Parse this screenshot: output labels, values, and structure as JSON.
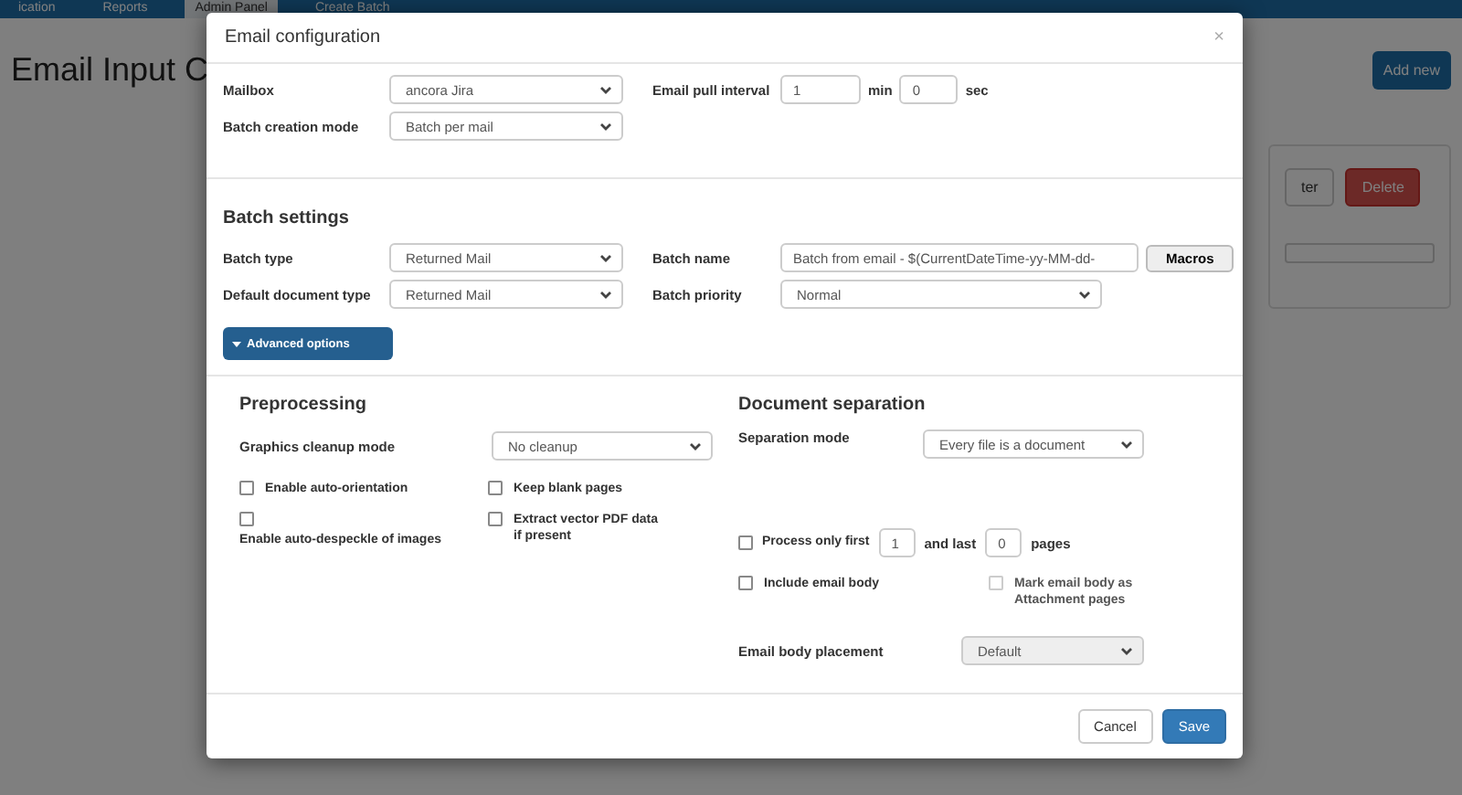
{
  "background": {
    "nav_tabs": [
      {
        "label": "ication",
        "selected": false
      },
      {
        "label": "Reports",
        "selected": false
      },
      {
        "label": "Admin Panel",
        "selected": true
      },
      {
        "label": "Create Batch",
        "selected": false
      }
    ],
    "page_title": "Email Input C",
    "add_button": "Add new",
    "card_buttons": [
      {
        "label": "ter",
        "kind": "default"
      },
      {
        "label": "Delete",
        "kind": "danger"
      }
    ]
  },
  "dialog": {
    "title": "Email configuration",
    "close": "×",
    "general": {
      "mailbox": {
        "label": "Mailbox",
        "value": "ancora Jira"
      },
      "creation_mode": {
        "label": "Batch creation mode",
        "value": "Batch per mail"
      },
      "pull_interval": {
        "label": "Email pull interval",
        "minutes": "1",
        "min_unit": "min",
        "seconds": "0",
        "sec_unit": "sec"
      }
    },
    "batch_settings": {
      "heading": "Batch settings",
      "batch_type": {
        "label": "Batch type",
        "value": "Returned Mail"
      },
      "batch_name": {
        "label": "Batch name",
        "value": "Batch from email - $(CurrentDateTime-yy-MM-dd-",
        "button": "Macros"
      },
      "document_type": {
        "label": "Default document type",
        "value": "Returned Mail"
      },
      "priority": {
        "label": "Batch priority",
        "value": "Normal"
      },
      "advanced": {
        "label": "Advanced options",
        "expanded": true
      }
    },
    "preprocessing": {
      "heading": "Preprocessing",
      "cleanup": {
        "label": "Graphics cleanup mode",
        "value": "No cleanup"
      },
      "checkboxes": [
        {
          "label": "Enable auto-orientation",
          "checked": false,
          "disabled": false
        },
        {
          "label": "Keep blank pages",
          "checked": false,
          "disabled": false
        },
        {
          "label": "Enable auto-despeckle of images",
          "checked": false,
          "disabled": false
        },
        {
          "label": "Extract vector PDF data if present",
          "checked": false,
          "disabled": false
        }
      ]
    },
    "separation": {
      "heading": "Document separation",
      "mode": {
        "label": "Separation mode",
        "value": "Every file is a document"
      },
      "process_pages": {
        "checked": false,
        "label": "Process only first",
        "first": "1",
        "middle": "and last",
        "last": "0",
        "unit": "pages"
      },
      "include_body": {
        "label": "Include email body",
        "checked": false
      },
      "mark_body": {
        "label": "Mark email body as Attachment pages",
        "checked": false,
        "disabled": true
      },
      "placement": {
        "label": "Email body placement",
        "value": "Default",
        "disabled": true
      }
    },
    "buttons": [
      {
        "label": "Cancel",
        "kind": "default"
      },
      {
        "label": "Save",
        "kind": "primary"
      }
    ]
  }
}
